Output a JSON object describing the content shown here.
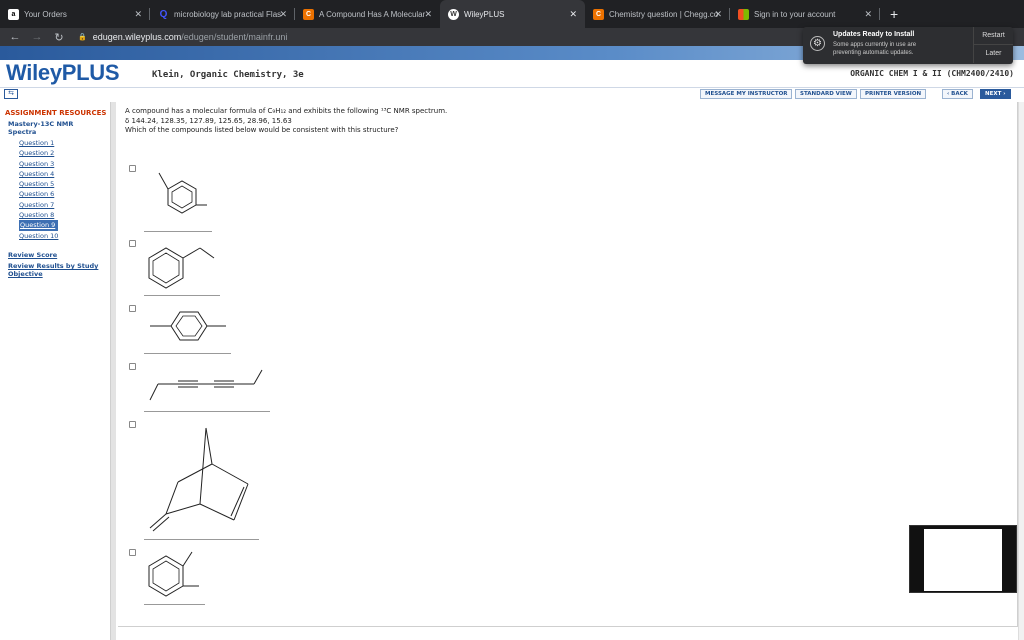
{
  "browser": {
    "tabs": [
      {
        "label": "Your Orders",
        "icon": "amazon-icon",
        "color": "#ffffff",
        "active": false
      },
      {
        "label": "microbiology lab practical Flas",
        "icon": "quizlet-icon",
        "color": "#4255ff",
        "active": false
      },
      {
        "label": "A Compound Has A Molecular",
        "icon": "chegg-icon",
        "color": "#eb7100",
        "active": false
      },
      {
        "label": "WileyPLUS",
        "icon": "wileyplus-icon",
        "color": "#ffffff",
        "active": true
      },
      {
        "label": "Chemistry question | Chegg.co",
        "icon": "chegg-icon",
        "color": "#eb7100",
        "active": false
      },
      {
        "label": "Sign in to your account",
        "icon": "microsoft-icon",
        "color": "#f25022",
        "active": false
      }
    ],
    "new_tab": "+",
    "url_host": "edugen.wileyplus.com",
    "url_path": "/edugen/student/mainfr.uni"
  },
  "notification": {
    "title": "Updates Ready to Install",
    "body": "Some apps currently in use are preventing automatic updates.",
    "restart": "Restart",
    "later": "Later"
  },
  "header": {
    "logo": "WileyPLUS",
    "book_title": "Klein, Organic Chemistry, 3e",
    "course": "ORGANIC CHEM I & II (CHM2400/2410)"
  },
  "topbar": {
    "message": "MESSAGE MY INSTRUCTOR",
    "standard": "STANDARD VIEW",
    "printer": "PRINTER VERSION",
    "back": "‹ BACK",
    "next": "NEXT ›"
  },
  "sidebar": {
    "heading": "ASSIGNMENT RESOURCES",
    "assignment": "Mastery-13C NMR Spectra",
    "questions": [
      "Question 1",
      "Question 2",
      "Question 3",
      "Question 4",
      "Question 5",
      "Question 6",
      "Question 7",
      "Question 8",
      "Question 9",
      "Question 10"
    ],
    "selected_index": 8,
    "review_score": "Review Score",
    "review_results": "Review Results by Study Objective"
  },
  "question": {
    "line1": "A compound has a molecular formula of C₉H₁₂ and exhibits the following ¹³C NMR spectrum.",
    "line2": "δ 144.24, 128.35, 127.89, 125.65, 28.96, 15.63",
    "line3": "Which of the compounds listed below would be consistent with this structure?"
  }
}
